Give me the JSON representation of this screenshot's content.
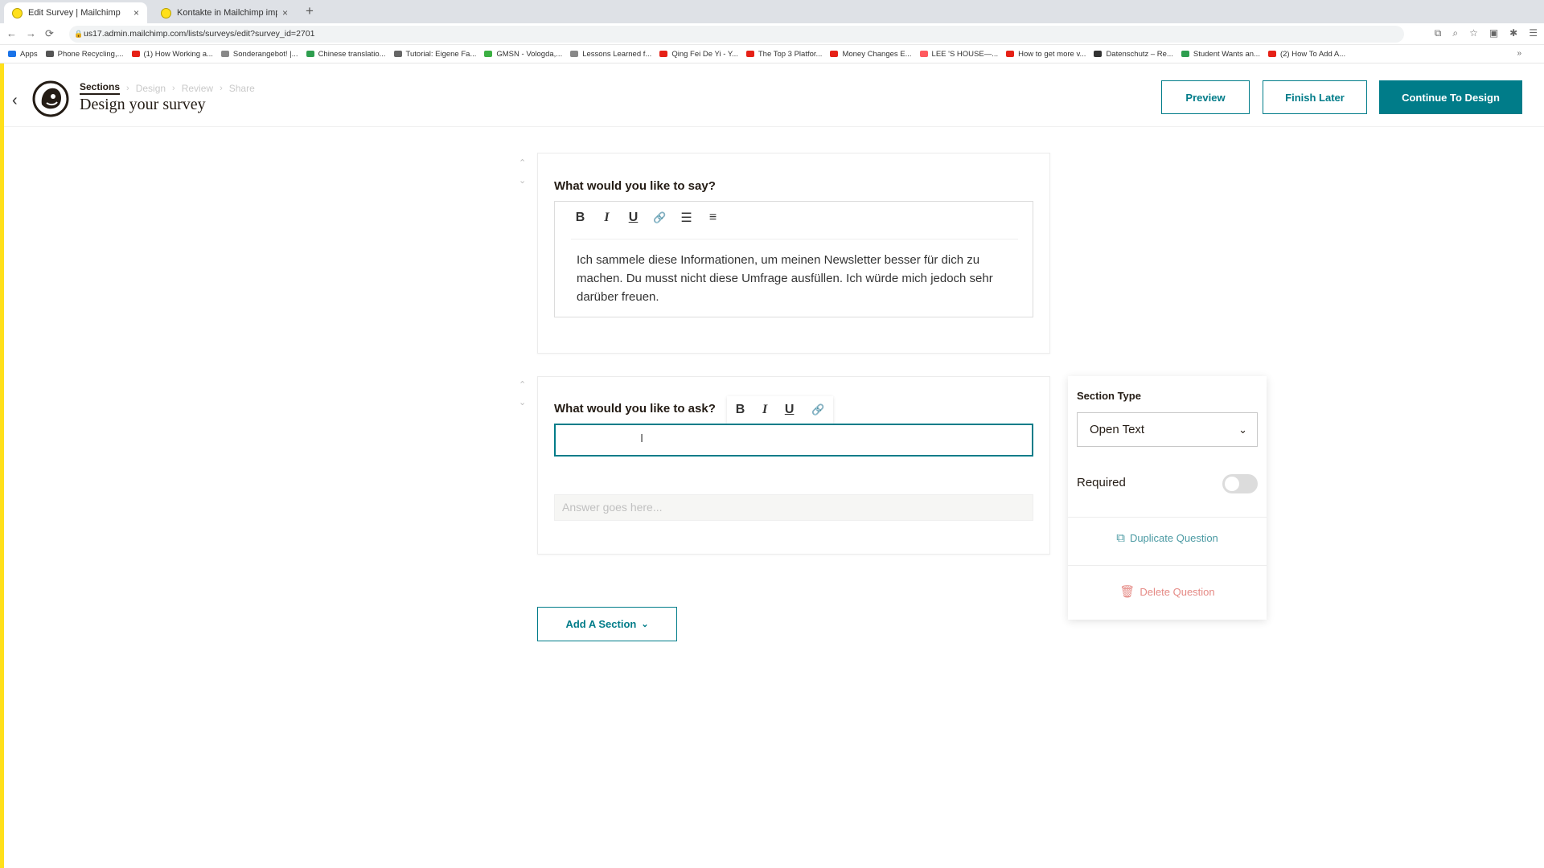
{
  "browser": {
    "tabs": [
      {
        "label": "Edit Survey | Mailchimp",
        "close": "×"
      },
      {
        "label": "Kontakte in Mailchimp importie",
        "close": "×"
      }
    ],
    "new_tab": "+",
    "nav": {
      "back": "←",
      "forward": "→",
      "reload": "⟳"
    },
    "url": "us17.admin.mailchimp.com/lists/surveys/edit?survey_id=2701",
    "bookmarks": [
      {
        "label": "Apps",
        "color": "#1a73e8"
      },
      {
        "label": "Phone Recycling,...",
        "color": "#555555"
      },
      {
        "label": "(1) How Working a...",
        "color": "#e62117"
      },
      {
        "label": "Sonderangebot! |...",
        "color": "#888888"
      },
      {
        "label": "Chinese translatio...",
        "color": "#2e9e4f"
      },
      {
        "label": "Tutorial: Eigene Fa...",
        "color": "#666666"
      },
      {
        "label": "GMSN - Vologda,...",
        "color": "#3cb043"
      },
      {
        "label": "Lessons Learned f...",
        "color": "#888888"
      },
      {
        "label": "Qing Fei De Yi - Y...",
        "color": "#e62117"
      },
      {
        "label": "The Top 3 Platfor...",
        "color": "#e62117"
      },
      {
        "label": "Money Changes E...",
        "color": "#e62117"
      },
      {
        "label": "LEE 'S HOUSE—...",
        "color": "#ff5a5f"
      },
      {
        "label": "How to get more v...",
        "color": "#e62117"
      },
      {
        "label": "Datenschutz – Re...",
        "color": "#333333"
      },
      {
        "label": "Student Wants an...",
        "color": "#2e9e4f"
      },
      {
        "label": "(2) How To Add A...",
        "color": "#e62117"
      }
    ],
    "bookmarks_more": "»"
  },
  "header": {
    "breadcrumb": [
      "Sections",
      "Design",
      "Review",
      "Share"
    ],
    "breadcrumb_sep": "›",
    "title": "Design your survey",
    "back": "‹",
    "buttons": {
      "preview": "Preview",
      "finish_later": "Finish Later",
      "continue": "Continue To Design"
    }
  },
  "colors": {
    "accent": "#007c89",
    "brand_yellow": "#ffe01b",
    "delete": "#e58a85"
  },
  "sections": [
    {
      "label": "What would you like to say?",
      "toolbar": [
        "B",
        "I",
        "U",
        "🔗",
        "☰",
        "≡"
      ],
      "text": "Ich sammele diese Informationen, um meinen Newsletter besser für dich zu machen. Du musst nicht diese Umfrage ausfüllen. Ich würde mich jedoch sehr darüber freuen."
    },
    {
      "label": "What would you like to ask?",
      "toolbar": [
        "B",
        "I",
        "U",
        "🔗"
      ],
      "input_value": "",
      "cursor": "I",
      "answer_placeholder": "Answer goes here..."
    }
  ],
  "settings": {
    "section_type_label": "Section Type",
    "section_type_value": "Open Text",
    "required_label": "Required",
    "required": false,
    "duplicate": "Duplicate Question",
    "delete": "Delete Question"
  },
  "add_section": "Add A Section"
}
